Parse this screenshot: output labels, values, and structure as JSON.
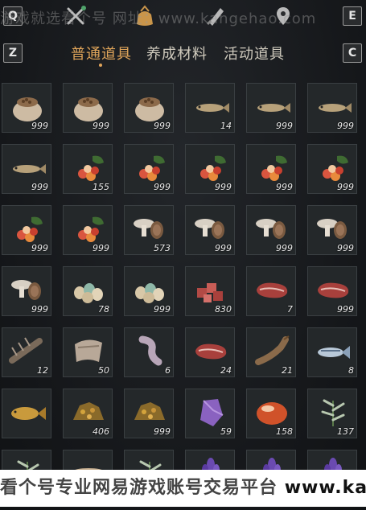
{
  "watermark_top": "游戏就选看个号 网址：www.kangehao.com",
  "watermark_bottom": {
    "text": "看个号专业网易游戏账号交易平台",
    "url": "www.kangehao.com"
  },
  "keys": {
    "left_top": "Q",
    "right_top": "E",
    "left": "Z",
    "right": "C"
  },
  "top_icons": [
    "crossed-tools-icon",
    "bag-icon",
    "scroll-icon",
    "map-pin-icon"
  ],
  "tabs": [
    {
      "label": "普通道具",
      "active": true
    },
    {
      "label": "养成材料",
      "active": false
    },
    {
      "label": "活动道具",
      "active": false
    }
  ],
  "items": [
    {
      "icon": "grain-sack",
      "qty": "999"
    },
    {
      "icon": "grain-sack",
      "qty": "999"
    },
    {
      "icon": "grain-sack",
      "qty": "999"
    },
    {
      "icon": "fish",
      "qty": "14"
    },
    {
      "icon": "fish",
      "qty": "999"
    },
    {
      "icon": "fish",
      "qty": "999"
    },
    {
      "icon": "fish",
      "qty": "999"
    },
    {
      "icon": "red-berries",
      "qty": "155"
    },
    {
      "icon": "red-berries",
      "qty": "999"
    },
    {
      "icon": "red-berries",
      "qty": "999"
    },
    {
      "icon": "red-berries",
      "qty": "999"
    },
    {
      "icon": "red-berries",
      "qty": "999"
    },
    {
      "icon": "red-berries",
      "qty": "999"
    },
    {
      "icon": "red-berries",
      "qty": "999"
    },
    {
      "icon": "mushrooms",
      "qty": "573"
    },
    {
      "icon": "mushrooms",
      "qty": "999"
    },
    {
      "icon": "mushrooms",
      "qty": "999"
    },
    {
      "icon": "mushrooms",
      "qty": "999"
    },
    {
      "icon": "mushrooms",
      "qty": "999"
    },
    {
      "icon": "eggs",
      "qty": "78"
    },
    {
      "icon": "eggs",
      "qty": "999"
    },
    {
      "icon": "meat-cubes",
      "qty": "830"
    },
    {
      "icon": "steak",
      "qty": "7"
    },
    {
      "icon": "steak",
      "qty": "999"
    },
    {
      "icon": "spiny-fish",
      "qty": "12"
    },
    {
      "icon": "hide",
      "qty": "50"
    },
    {
      "icon": "intestine",
      "qty": "6"
    },
    {
      "icon": "steak",
      "qty": "24"
    },
    {
      "icon": "catfish",
      "qty": "21"
    },
    {
      "icon": "blue-fish",
      "qty": "8"
    },
    {
      "icon": "carp",
      "qty": ""
    },
    {
      "icon": "ore",
      "qty": "406"
    },
    {
      "icon": "ore",
      "qty": "999"
    },
    {
      "icon": "amethyst",
      "qty": "59"
    },
    {
      "icon": "amber-gem",
      "qty": "158"
    },
    {
      "icon": "herb",
      "qty": "137"
    },
    {
      "icon": "herb",
      "qty": ""
    },
    {
      "icon": "bowl",
      "qty": ""
    },
    {
      "icon": "herb",
      "qty": ""
    },
    {
      "icon": "purple-flower",
      "qty": ""
    },
    {
      "icon": "purple-flower",
      "qty": ""
    },
    {
      "icon": "purple-flower",
      "qty": ""
    }
  ]
}
